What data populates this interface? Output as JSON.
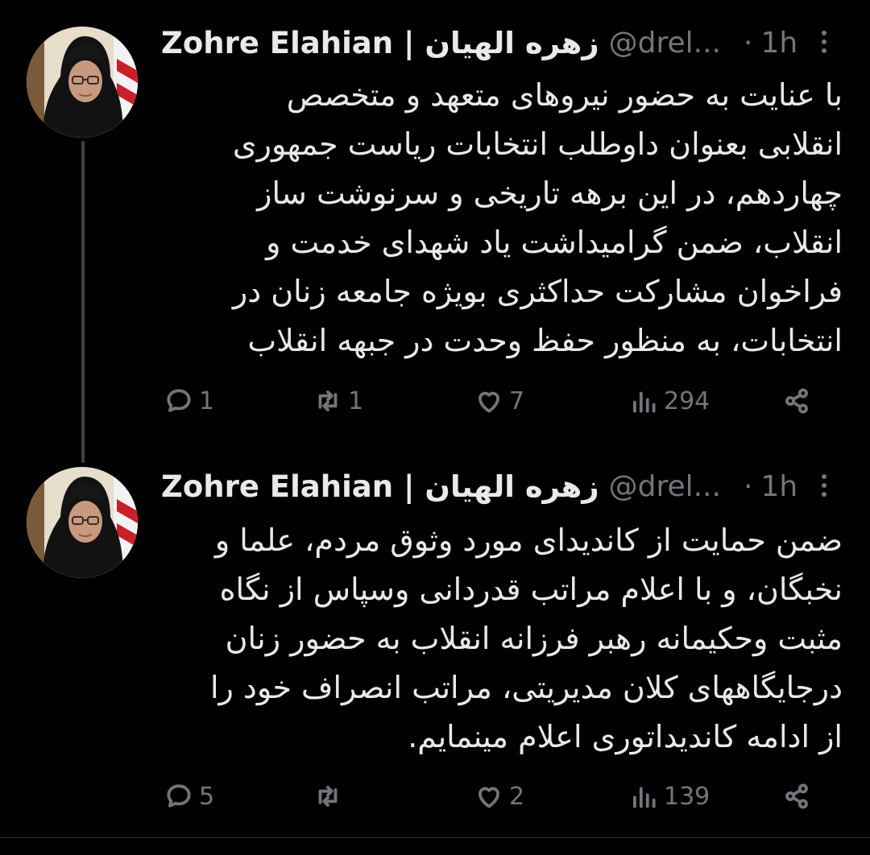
{
  "tweets": [
    {
      "author_name": "Zohre Elahian | زهره الهیان",
      "handle": "@drel...",
      "separator": "·",
      "time": "1h",
      "lines": [
        "با عنایت به حضور نیروهای متعهد و متخصص",
        "انقلابی بعنوان داوطلب انتخابات ریاست جمهوری",
        "چهاردهم، در این برهه تاریخی و  سرنوشت ساز",
        "انقلاب، ضمن گرامیداشت یاد شهدای خدمت و",
        "فراخوان مشارکت حداکثری بویژه جامعه زنان در",
        "انتخابات، به منظور حفظ وحدت در جبهه انقلاب"
      ],
      "stats": {
        "replies": "1",
        "retweets": "1",
        "likes": "7",
        "views": "294"
      }
    },
    {
      "author_name": "Zohre Elahian | زهره الهیان",
      "handle": "@drel...",
      "separator": "·",
      "time": "1h",
      "lines": [
        "ضمن حمایت از کاندیدای مورد وثوق مردم، علما و",
        "نخبگان، و با اعلام مراتب قدردانی وسپاس از نگاه",
        "مثبت وحکیمانه رهبر فرزانه انقلاب به حضور زنان",
        "درجایگاههای کلان مدیریتی، مراتب انصراف خود را",
        "از ادامه کاندیداتوری  اعلام مینمایم."
      ],
      "stats": {
        "replies": "5",
        "retweets": "",
        "likes": "2",
        "views": "139"
      }
    }
  ],
  "icons": {
    "reply": "reply-icon",
    "retweet": "retweet-icon",
    "like": "heart-icon",
    "views": "views-icon",
    "share": "share-icon",
    "more": "more-icon"
  },
  "colors": {
    "background": "#000000",
    "text": "#e7e9ea",
    "muted": "#71767b",
    "thread_line": "#3e4144"
  }
}
